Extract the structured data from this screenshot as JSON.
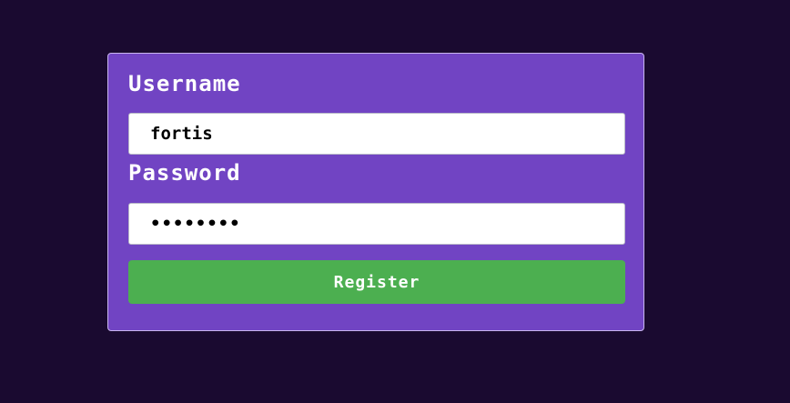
{
  "colors": {
    "page_background": "#1a0a30",
    "card_background": "#7144c3",
    "button_background": "#4caf50",
    "text_light": "#ffffff"
  },
  "form": {
    "username_label": "Username",
    "username_value": "fortis",
    "password_label": "Password",
    "password_value": "oldpass1",
    "register_label": "Register"
  }
}
